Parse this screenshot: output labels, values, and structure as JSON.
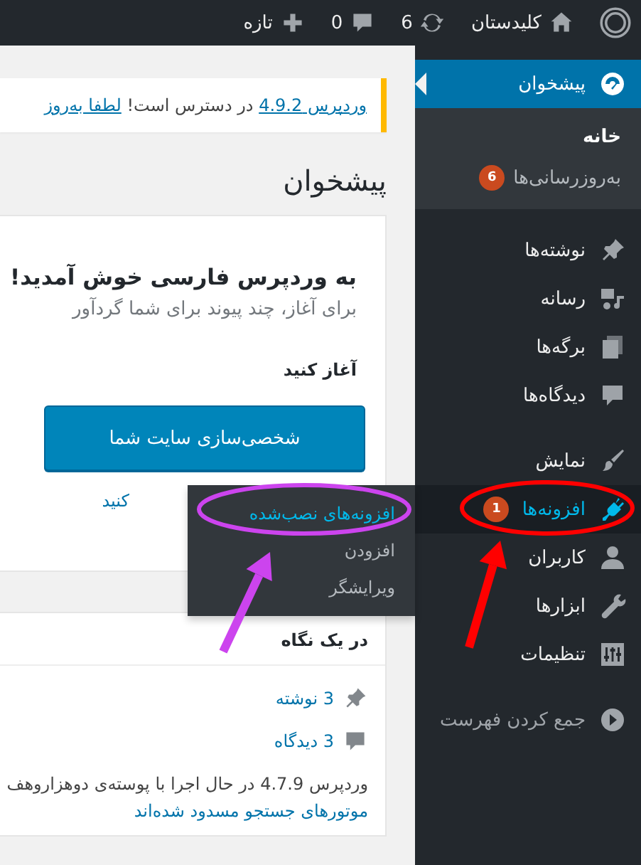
{
  "admin_bar": {
    "items": [
      {
        "kind": "logo"
      },
      {
        "kind": "site",
        "label": "کلیدستان"
      },
      {
        "kind": "updates",
        "label": "6"
      },
      {
        "kind": "comments",
        "label": "0"
      },
      {
        "kind": "new",
        "label": "تازه"
      }
    ]
  },
  "sidebar": {
    "groups": [
      [
        {
          "label": "پیشخوان",
          "selected": true,
          "hovered": false,
          "children": [
            {
              "label": "خانه",
              "selected": true
            },
            {
              "label": "به‌روزرسانی‌ها",
              "badge": "6",
              "selected": false
            }
          ]
        }
      ],
      [
        {
          "label": "نوشته‌ها",
          "selected": false,
          "hovered": false
        },
        {
          "label": "رسانه",
          "selected": false,
          "hovered": false
        },
        {
          "label": "برگه‌ها",
          "selected": false,
          "hovered": false
        },
        {
          "label": "دیدگاه‌ها",
          "selected": false,
          "hovered": false
        }
      ],
      [
        {
          "label": "نمایش",
          "selected": false,
          "hovered": false
        },
        {
          "label": "افزونه‌ها",
          "badge": "1",
          "selected": false,
          "hovered": true,
          "flyout": [
            {
              "label": "افزونه‌های نصب‌شده",
              "selected": true
            },
            {
              "label": "افزودن",
              "selected": false
            },
            {
              "label": "ویرایشگر",
              "selected": false
            }
          ]
        },
        {
          "label": "کاربران",
          "selected": false,
          "hovered": false
        },
        {
          "label": "ابزارها",
          "selected": false,
          "hovered": false
        },
        {
          "label": "تنظیمات",
          "selected": false,
          "hovered": false
        }
      ]
    ],
    "collapse": "جمع کردن فهرست"
  },
  "notice": {
    "parts": [
      {
        "text": "وردپرس 4.9.2",
        "link": true
      },
      {
        "text": "در دسترس است!",
        "link": false
      },
      {
        "text": "لطفا به‌روز",
        "link": true
      }
    ]
  },
  "page_title": "پیشخوان",
  "welcome": {
    "title": "به وردپرس فارسی خوش آمدید!",
    "subtitle": "برای آغاز، چند پیوند برای شما گردآور",
    "section_title": "آغاز کنید",
    "button": "شخصی‌سازی سایت شما",
    "link": "کنید"
  },
  "at_a_glance": {
    "title": "در یک نگاه",
    "items": [
      {
        "text": "3 نوشته"
      },
      {
        "text": "3 دیدگاه"
      }
    ],
    "version_text": "وردپرس 4.7.9 در حال اجرا با پوسته‌ی دوهزاروهف",
    "search_notice": "موتورهای جستجو مسدود شده‌اند"
  },
  "annotations": [
    {
      "kind": "ellipse",
      "color": "#ff0000"
    },
    {
      "kind": "arrow",
      "color": "#ff0000"
    },
    {
      "kind": "ellipse",
      "color": "#cc44ee"
    },
    {
      "kind": "arrow",
      "color": "#cc44ee"
    }
  ]
}
